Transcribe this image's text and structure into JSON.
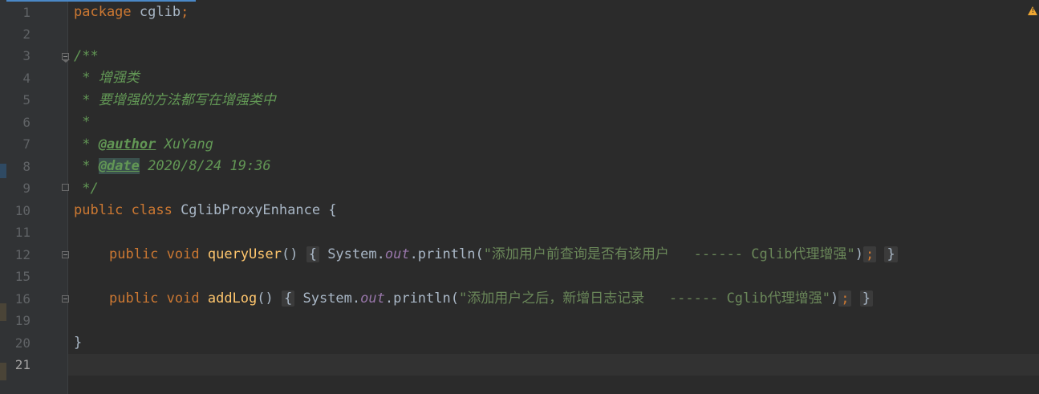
{
  "editor": {
    "line_numbers": [
      "1",
      "2",
      "3",
      "4",
      "5",
      "6",
      "7",
      "8",
      "9",
      "10",
      "11",
      "12",
      "15",
      "16",
      "19",
      "20",
      "21"
    ],
    "lines": {
      "l1": {
        "kw": "package",
        "rest": " cglib",
        "semi": ";"
      },
      "l3": {
        "doc": "/**"
      },
      "l4": {
        "doc": " * 增强类"
      },
      "l5": {
        "doc": " * 要增强的方法都写在增强类中"
      },
      "l6": {
        "doc": " *"
      },
      "l7": {
        "doc": " * ",
        "tag": "@author",
        "value": " XuYang"
      },
      "l8": {
        "doc": " * ",
        "tag": "@date",
        "value": " 2020/8/24 19:36"
      },
      "l9": {
        "doc": " */"
      },
      "l10": {
        "kw": "public class",
        "name": " CglibProxyEnhance ",
        "brace": "{"
      },
      "l12": {
        "kw": "public void",
        "method": "queryUser",
        "parens": "()",
        "lbrace": "{",
        "sys": " System.",
        "out": "out",
        "call": ".println(",
        "str": "\"添加用户前查询是否有该用户   ------ Cglib代理增强\"",
        "close": ")",
        "semi": ";",
        "rbrace": "}"
      },
      "l16": {
        "kw": "public void",
        "method": "addLog",
        "parens": "()",
        "lbrace": "{",
        "sys": " System.",
        "out": "out",
        "call": ".println(",
        "str": "\"添加用户之后，新增日志记录   ------ Cglib代理增强\"",
        "close": ")",
        "semi": ";",
        "rbrace": "}"
      },
      "l20": {
        "brace": "}"
      }
    },
    "current_line": "21"
  },
  "colors": {
    "background": "#2b2b2b",
    "keyword": "#cc7832",
    "string": "#6a8759",
    "method": "#ffc66d",
    "doc": "#629755"
  },
  "icons": {
    "warning": "warning-icon",
    "fold": "fold-marker-icon"
  }
}
